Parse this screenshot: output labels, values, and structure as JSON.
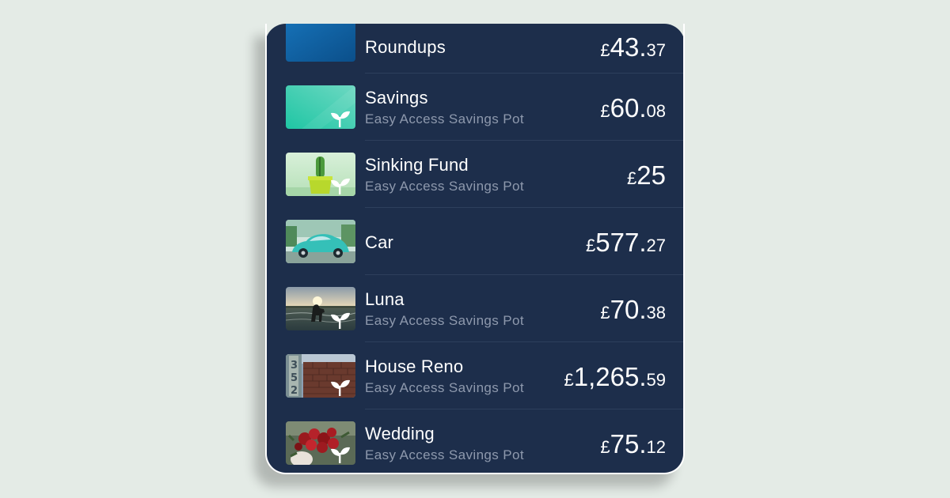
{
  "pots": [
    {
      "name": "Roundups",
      "subtitle": "",
      "currency": "£",
      "major": "43.",
      "minor": "37",
      "thumb": "blue-gradient"
    },
    {
      "name": "Savings",
      "subtitle": "Easy Access Savings Pot",
      "currency": "£",
      "major": "60.",
      "minor": "08",
      "thumb": "teal-gradient-sprout-icon"
    },
    {
      "name": "Sinking Fund",
      "subtitle": "Easy Access Savings Pot",
      "currency": "£",
      "major": "25",
      "minor": "",
      "thumb": "cactus-pot-sprout-icon"
    },
    {
      "name": "Car",
      "subtitle": "",
      "currency": "£",
      "major": "577.",
      "minor": "27",
      "thumb": "teal-car-photo"
    },
    {
      "name": "Luna",
      "subtitle": "Easy Access Savings Pot",
      "currency": "£",
      "major": "70.",
      "minor": "38",
      "thumb": "dog-sunset-photo-sprout-icon"
    },
    {
      "name": "House Reno",
      "subtitle": "Easy Access Savings Pot",
      "currency": "£",
      "major": "1,265.",
      "minor": "59",
      "thumb": "house-number-brick-photo-sprout-icon"
    },
    {
      "name": "Wedding",
      "subtitle": "Easy Access Savings Pot",
      "currency": "£",
      "major": "75.",
      "minor": "12",
      "thumb": "red-roses-bouquet-photo-sprout-icon"
    }
  ],
  "colors": {
    "background": "#e4ebe6",
    "card": "#1d2e4b",
    "divider": "#2d3f5c",
    "subtitle": "#8e99ad",
    "text": "#ffffff"
  }
}
